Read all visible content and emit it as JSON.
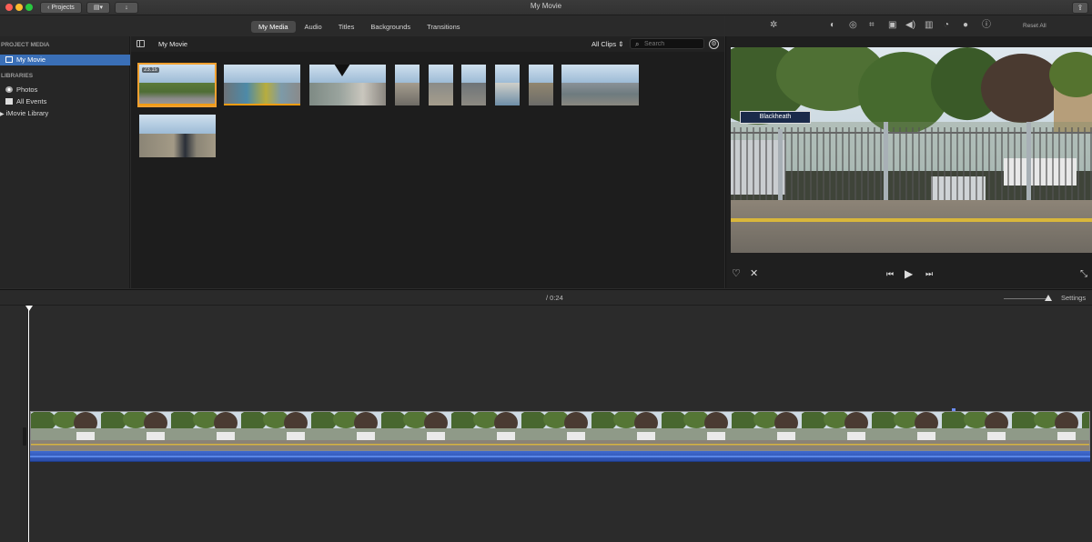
{
  "window": {
    "title": "My Movie"
  },
  "titlebar": {
    "projects_label": "Projects",
    "share_icon": "share-icon"
  },
  "media_tabs": [
    {
      "label": "My Media",
      "active": true
    },
    {
      "label": "Audio",
      "active": false
    },
    {
      "label": "Titles",
      "active": false
    },
    {
      "label": "Backgrounds",
      "active": false
    },
    {
      "label": "Transitions",
      "active": false
    }
  ],
  "viewer_toolbar": {
    "reset_label": "Reset All",
    "icons": [
      "magic-wand-icon",
      "color-balance-icon",
      "color-correction-icon",
      "crop-icon",
      "stabilization-icon",
      "volume-icon",
      "noise-reduction-icon",
      "speed-icon",
      "clip-filter-icon",
      "info-icon"
    ]
  },
  "sidebar": {
    "project_media_header": "PROJECT MEDIA",
    "project_item": "My Movie",
    "libraries_header": "LIBRARIES",
    "items": [
      {
        "label": "Photos",
        "icon": "photos-icon"
      },
      {
        "label": "All Events",
        "icon": "events-icon"
      },
      {
        "label": "iMovie Library",
        "icon": "disclosure-triangle-icon"
      }
    ]
  },
  "browser": {
    "title": "My Movie",
    "filter": "All Clips",
    "search_placeholder": "Search",
    "first_clip_duration": "23.1s"
  },
  "viewer": {
    "sign_text": "Blackheath",
    "controls": [
      "favorite-icon",
      "reject-icon",
      "skip-back-icon",
      "play-icon",
      "skip-forward-icon",
      "fullscreen-icon"
    ]
  },
  "timeline": {
    "time_display": "/  0:24",
    "settings_label": "Settings"
  },
  "colors": {
    "selection": "#3a6fb7",
    "clip_used": "#f39c12",
    "audio": "#3f6ad0"
  }
}
